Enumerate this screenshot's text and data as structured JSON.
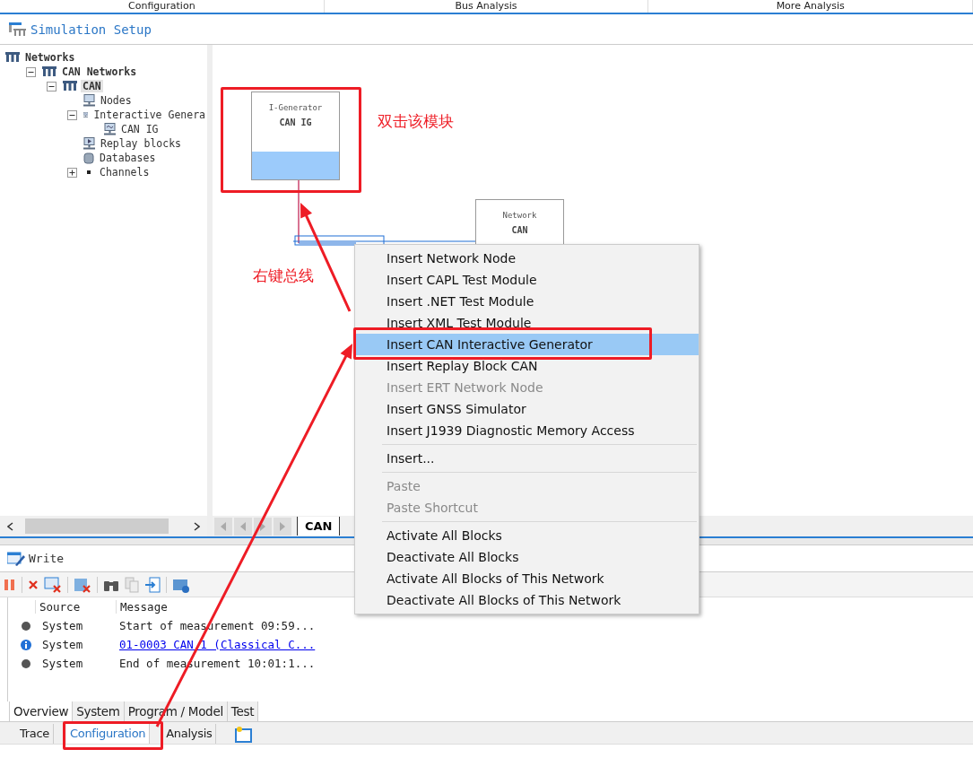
{
  "top_tabs": [
    "Configuration",
    "Bus Analysis",
    "More Analysis"
  ],
  "panel_title": "Simulation Setup",
  "tree": [
    {
      "label": "Networks",
      "kind": "network",
      "bold": true,
      "children": [
        {
          "label": "CAN Networks",
          "kind": "network",
          "bold": true,
          "expanded": true,
          "children": [
            {
              "label": "CAN",
              "kind": "network",
              "bold": true,
              "expanded": true,
              "selected": true,
              "children": [
                {
                  "label": "Nodes",
                  "kind": "node",
                  "bold": false,
                  "selected": false
                },
                {
                  "label": "Interactive Genera",
                  "kind": "generator",
                  "bold": false,
                  "expanded": true,
                  "selected": false,
                  "children": [
                    {
                      "label": "CAN IG",
                      "kind": "generator",
                      "bold": false,
                      "selected": false
                    }
                  ]
                },
                {
                  "label": "Replay blocks",
                  "kind": "replay",
                  "bold": false,
                  "selected": false
                },
                {
                  "label": "Databases",
                  "kind": "database",
                  "bold": false,
                  "selected": false
                },
                {
                  "label": "Channels",
                  "kind": "channel",
                  "bold": false,
                  "expanded": false,
                  "selected": false
                }
              ]
            }
          ]
        }
      ]
    }
  ],
  "canvas": {
    "blocks": [
      {
        "kind": "generator",
        "type_label": "I-Generator",
        "name": "CAN IG"
      },
      {
        "kind": "network",
        "type_label": "Network",
        "name": "CAN"
      }
    ],
    "tabs": [
      {
        "label": "CAN",
        "selected": true
      }
    ]
  },
  "context_menu": {
    "groups": [
      [
        {
          "label": "Insert Network Node",
          "disabled": false,
          "selected": false
        },
        {
          "label": "Insert CAPL Test Module",
          "disabled": false,
          "selected": false
        },
        {
          "label": "Insert .NET Test Module",
          "disabled": false,
          "selected": false
        },
        {
          "label": "Insert XML Test Module",
          "disabled": false,
          "selected": false
        },
        {
          "label": "Insert CAN Interactive Generator",
          "disabled": false,
          "selected": true
        },
        {
          "label": "Insert Replay Block CAN",
          "disabled": false,
          "selected": false
        },
        {
          "label": "Insert ERT Network Node",
          "disabled": true,
          "selected": false
        },
        {
          "label": "Insert GNSS Simulator",
          "disabled": false,
          "selected": false
        },
        {
          "label": "Insert J1939 Diagnostic Memory Access",
          "disabled": false,
          "selected": false
        }
      ],
      [
        {
          "label": "Insert...",
          "disabled": false,
          "selected": false
        }
      ],
      [
        {
          "label": "Paste",
          "disabled": true,
          "selected": false
        },
        {
          "label": "Paste Shortcut",
          "disabled": true,
          "selected": false
        }
      ],
      [
        {
          "label": "Activate All Blocks",
          "disabled": false,
          "selected": false
        },
        {
          "label": "Deactivate All Blocks",
          "disabled": false,
          "selected": false
        },
        {
          "label": "Activate All Blocks of This Network",
          "disabled": false,
          "selected": false
        },
        {
          "label": "Deactivate All Blocks of This Network",
          "disabled": false,
          "selected": false
        }
      ]
    ]
  },
  "annotations": [
    "双击该模块",
    "右键总线"
  ],
  "write": {
    "title": "Write",
    "columns": [
      "Source",
      "Message"
    ],
    "rows": [
      {
        "kind": "dot",
        "source": "System",
        "message": "Start of measurement 09:59...",
        "link": false
      },
      {
        "kind": "info",
        "source": "System",
        "message": "01-0003 CAN 1 (Classical C...",
        "link": true
      },
      {
        "kind": "dot",
        "source": "System",
        "message": "End of measurement 10:01:1...",
        "link": false
      }
    ],
    "tabs": [
      {
        "label": "Overview",
        "selected": true
      },
      {
        "label": "System",
        "selected": false
      },
      {
        "label": "Program / Model",
        "selected": false
      },
      {
        "label": "Test",
        "selected": false
      }
    ]
  },
  "bottom_tabs": [
    {
      "label": "Trace",
      "selected": false
    },
    {
      "label": "Configuration",
      "selected": true
    },
    {
      "label": "Analysis",
      "selected": false
    }
  ]
}
